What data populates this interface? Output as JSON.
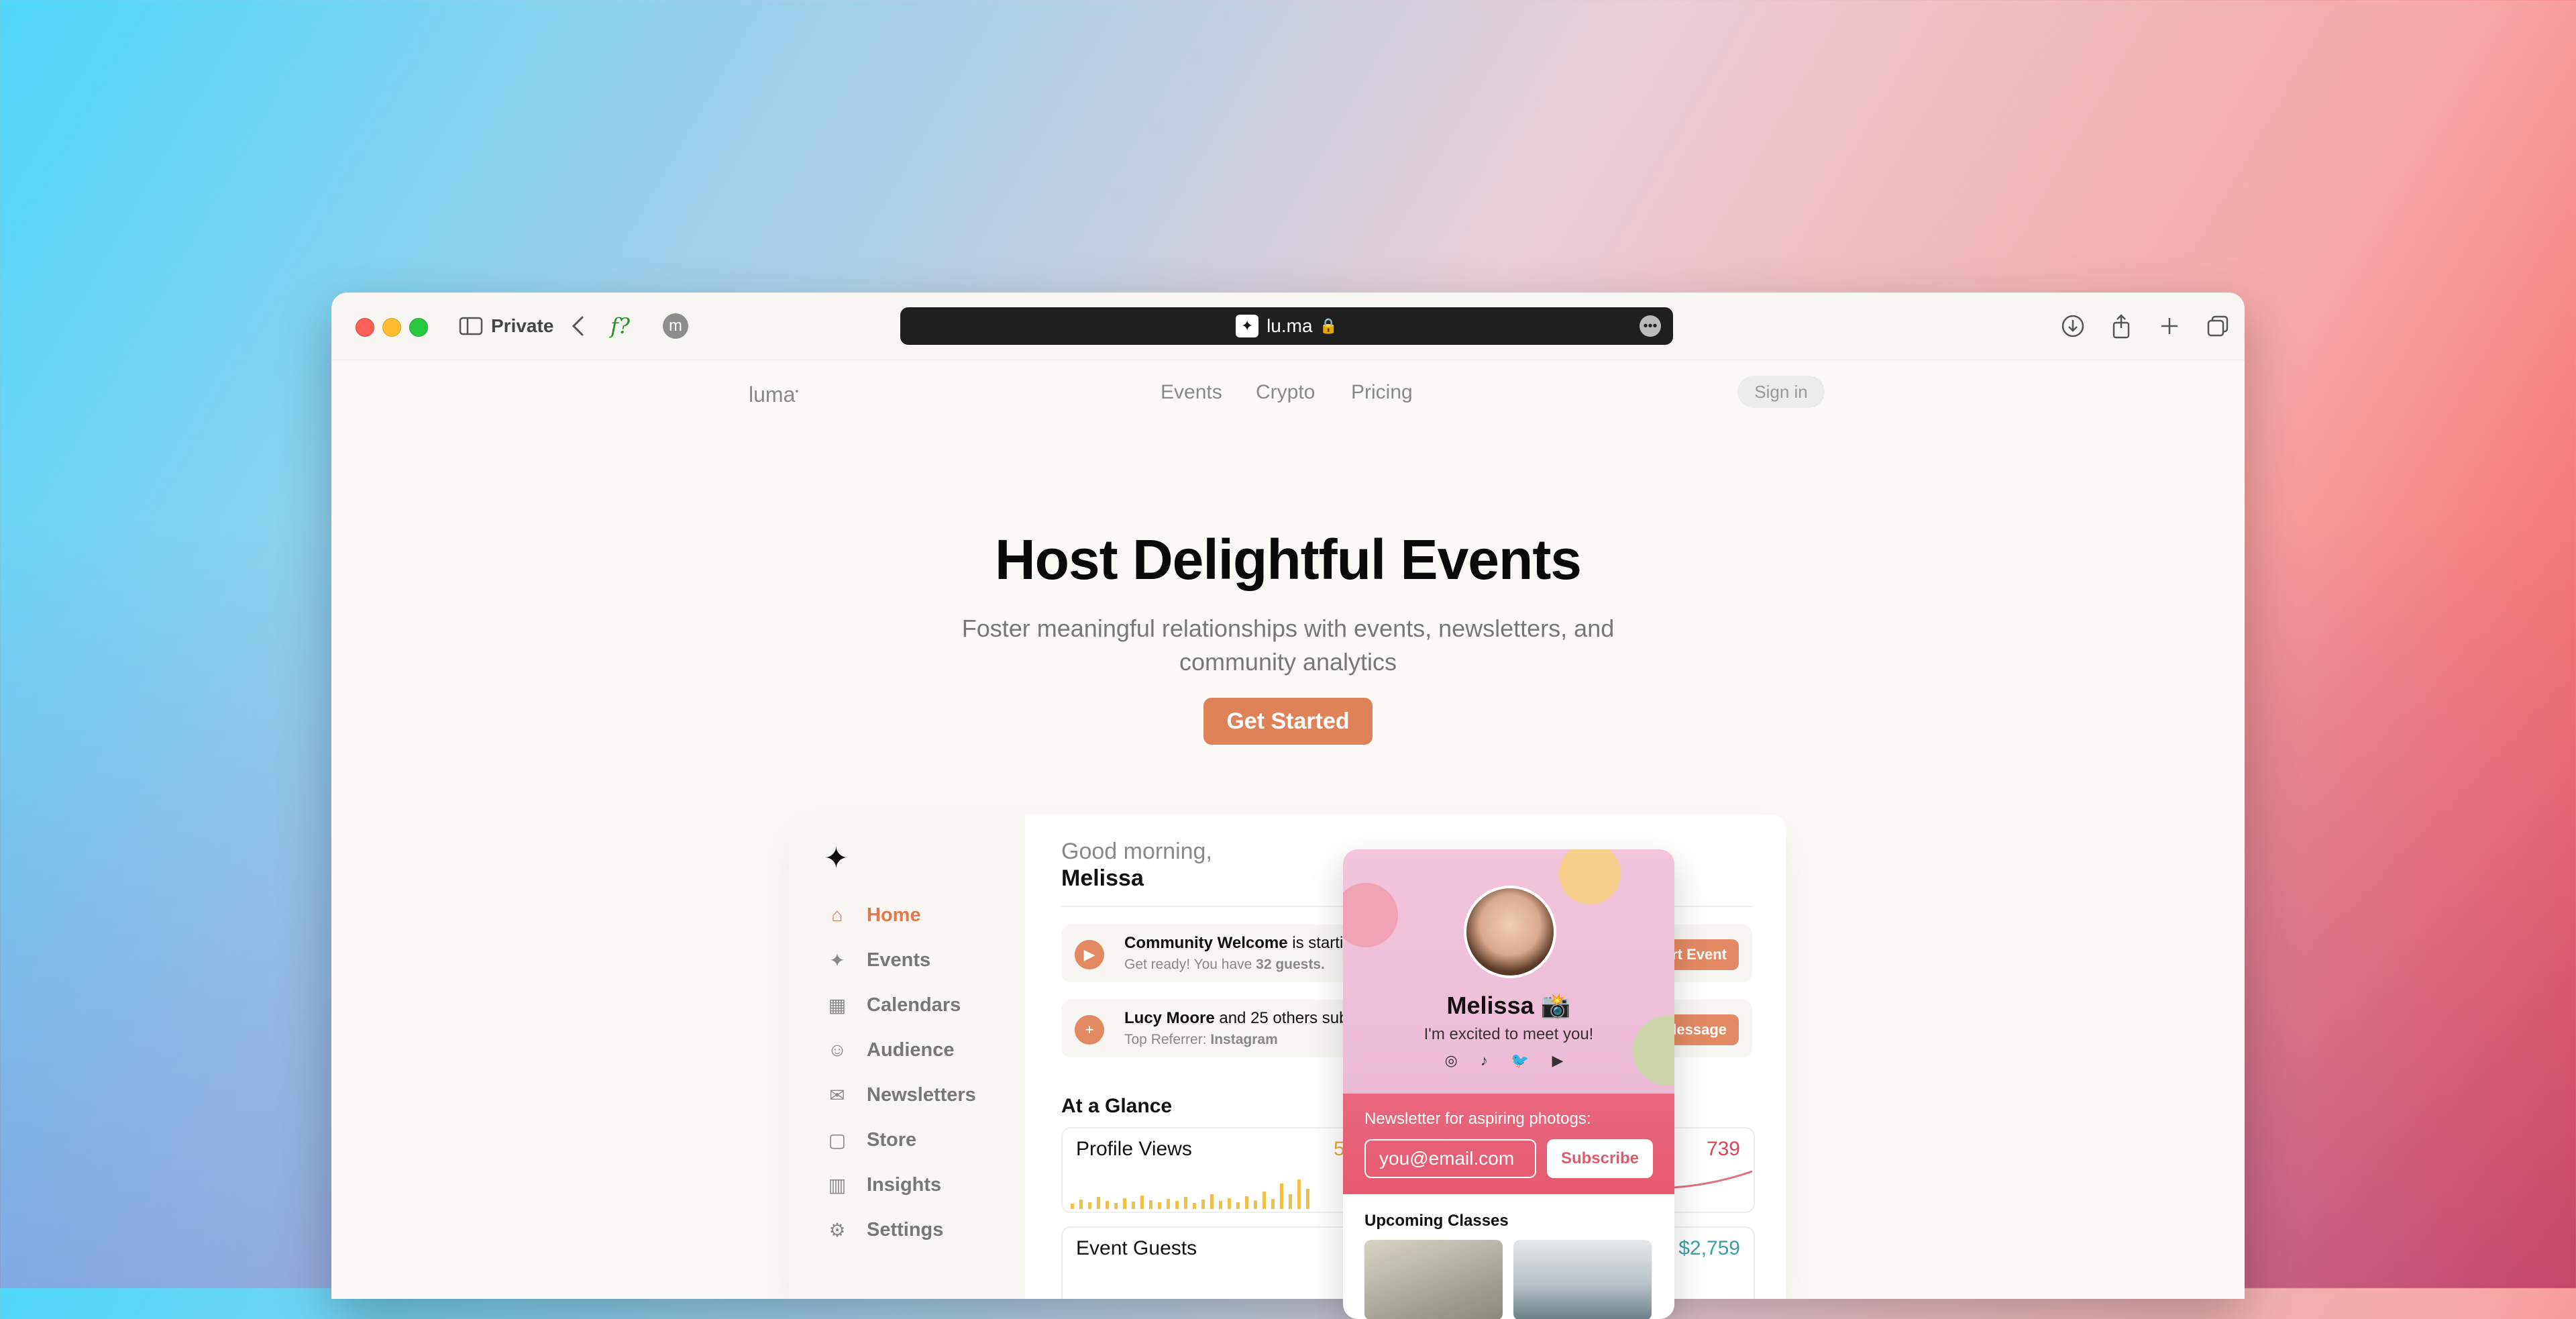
{
  "browser": {
    "private_label": "Private",
    "url": "lu.ma",
    "fx_label": "f?",
    "avatar_letter": "m"
  },
  "site": {
    "logo": "luma",
    "nav": [
      "Events",
      "Crypto",
      "Pricing"
    ],
    "signin": "Sign in"
  },
  "hero": {
    "title": "Host Delightful Events",
    "subtitle": "Foster meaningful relationships with events, newsletters, and community analytics",
    "cta": "Get Started"
  },
  "dashboard": {
    "greeting": "Good morning,",
    "user": "Melissa",
    "sidebar": [
      {
        "label": "Home",
        "icon": "home-icon",
        "glyph": "⌂",
        "active": true
      },
      {
        "label": "Events",
        "icon": "party-icon",
        "glyph": "✦",
        "active": false
      },
      {
        "label": "Calendars",
        "icon": "calendar-icon",
        "glyph": "▦",
        "active": false
      },
      {
        "label": "Audience",
        "icon": "people-icon",
        "glyph": "☺",
        "active": false
      },
      {
        "label": "Newsletters",
        "icon": "mail-icon",
        "glyph": "✉",
        "active": false
      },
      {
        "label": "Store",
        "icon": "bag-icon",
        "glyph": "▢",
        "active": false
      },
      {
        "label": "Insights",
        "icon": "chart-icon",
        "glyph": "▥",
        "active": false
      },
      {
        "label": "Settings",
        "icon": "gear-icon",
        "glyph": "⚙",
        "active": false
      }
    ],
    "notices": [
      {
        "title_bold": "Community Welcome",
        "title_rest": " is startin",
        "detail": "Get ready! You have ",
        "detail_bold": "32 guests.",
        "button": "rt Event"
      },
      {
        "title_bold": "Lucy Moore",
        "title_rest": " and 25 others sub",
        "detail": "Top Referrer: ",
        "detail_bold": "Instagram",
        "button": "lessage"
      }
    ],
    "glance": "At a Glance",
    "cards": [
      {
        "title": "Profile Views",
        "value": "739",
        "partial": "5"
      },
      {
        "title": "Event Guests",
        "value": "$2,759"
      }
    ]
  },
  "profile": {
    "name": "Melissa 📸",
    "tagline": "I'm excited to meet you!",
    "social": "◎ ♪ 🐦 ▶",
    "newsletter_title": "Newsletter for aspiring photogs:",
    "email_placeholder": "you@email.com",
    "subscribe": "Subscribe",
    "upcoming": "Upcoming Classes"
  },
  "colors": {
    "accent": "#e07a4c",
    "newsletter": "#e5637a"
  }
}
